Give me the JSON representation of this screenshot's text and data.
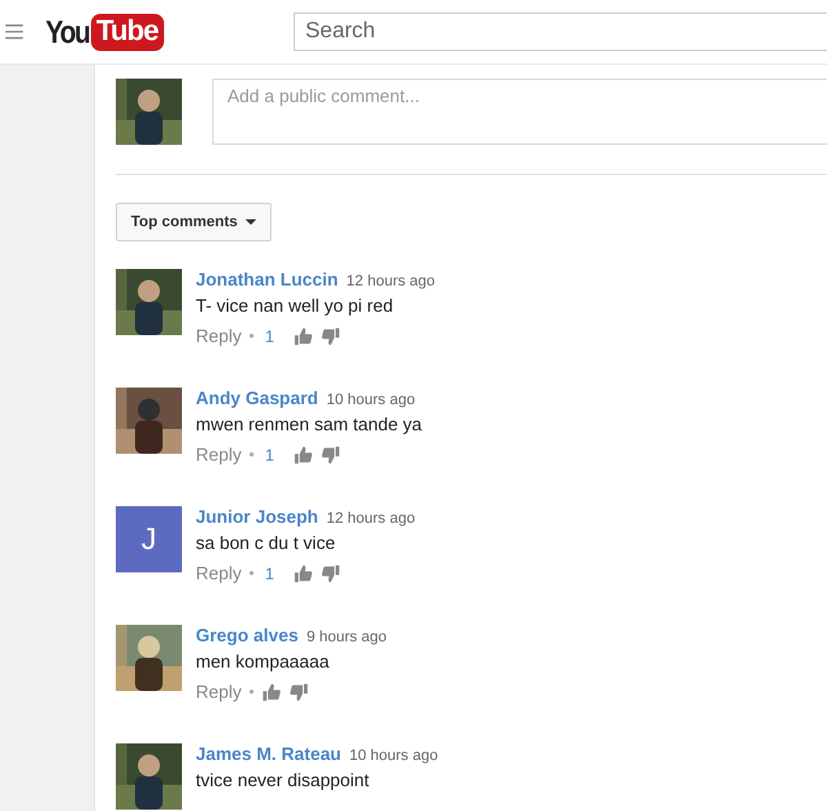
{
  "header": {
    "logo": {
      "left": "You",
      "right": "Tube"
    },
    "search": {
      "placeholder": "Search"
    }
  },
  "comment_box": {
    "placeholder": "Add a public comment..."
  },
  "sort_button": {
    "label": "Top comments"
  },
  "comments": [
    {
      "author": "Jonathan Luccin",
      "time": "12 hours ago",
      "text": "T- vice nan well yo pi red",
      "reply": "Reply",
      "likes": "1"
    },
    {
      "author": "Andy Gaspard",
      "time": "10 hours ago",
      "text": "mwen renmen sam tande ya",
      "reply": "Reply",
      "likes": "1"
    },
    {
      "author": "Junior Joseph",
      "time": "12 hours ago",
      "text": "sa bon c du t vice",
      "reply": "Reply",
      "likes": "1",
      "avatar": {
        "kind": "letter",
        "letter": "J",
        "color": "#5c6bc0"
      }
    },
    {
      "author": "Grego alves",
      "time": "9 hours ago",
      "text": "men kompaaaaa",
      "reply": "Reply"
    },
    {
      "author": "James M. Rateau",
      "time": "10 hours ago",
      "text": "tvice never disappoint"
    }
  ]
}
